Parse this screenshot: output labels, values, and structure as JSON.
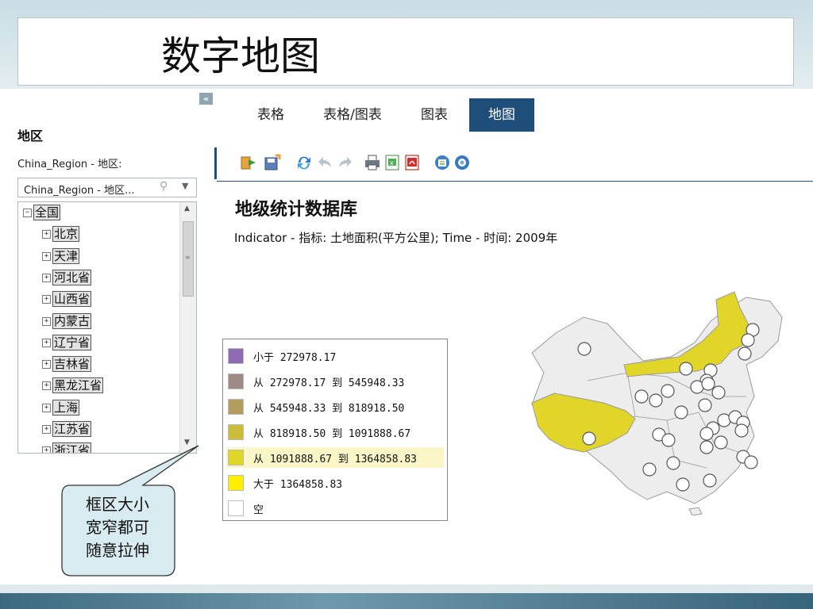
{
  "slide": {
    "title": "数字地图"
  },
  "left_panel": {
    "collapse_label": "«",
    "region_title": "地区",
    "region_subtitle": "China_Region - 地区:",
    "region_select_value": "China_Region - 地区...",
    "tree_items": [
      {
        "label": "全国",
        "toggle": "−"
      },
      {
        "label": "北京",
        "toggle": "+"
      },
      {
        "label": "天津",
        "toggle": "+"
      },
      {
        "label": "河北省",
        "toggle": "+"
      },
      {
        "label": "山西省",
        "toggle": "+"
      },
      {
        "label": "内蒙古",
        "toggle": "+"
      },
      {
        "label": "辽宁省",
        "toggle": "+"
      },
      {
        "label": "吉林省",
        "toggle": "+"
      },
      {
        "label": "黑龙江省",
        "toggle": "+"
      },
      {
        "label": "上海",
        "toggle": "+"
      },
      {
        "label": "江苏省",
        "toggle": "+"
      },
      {
        "label": "浙江省",
        "toggle": "+"
      }
    ]
  },
  "callout": {
    "lines": [
      "框区大小",
      "宽窄都可",
      "随意拉伸"
    ]
  },
  "tabs": [
    {
      "label": "表格",
      "active": false
    },
    {
      "label": "表格/图表",
      "active": false
    },
    {
      "label": "图表",
      "active": false
    },
    {
      "label": "地图",
      "active": true
    }
  ],
  "toolbar": {
    "icons": [
      "open-folder-icon",
      "save-icon",
      "refresh-icon",
      "undo-icon",
      "redo-icon",
      "print-icon",
      "excel-export-icon",
      "pdf-export-icon",
      "info-icon",
      "settings-icon"
    ]
  },
  "report": {
    "title": "地级统计数据库",
    "subtitle": "Indicator - 指标: 土地面积(平方公里); Time - 时间: 2009年"
  },
  "legend": {
    "items": [
      {
        "label": "小于 272978.17",
        "color": "#8e6bb0",
        "highlight": false
      },
      {
        "label": "从 272978.17 到 545948.33",
        "color": "#a08a86",
        "highlight": false
      },
      {
        "label": "从 545948.33 到 818918.50",
        "color": "#b29d5e",
        "highlight": false
      },
      {
        "label": "从 818918.50 到 1091888.67",
        "color": "#cdbb3a",
        "highlight": false
      },
      {
        "label": "从 1091888.67 到 1364858.83",
        "color": "#e2d52a",
        "highlight": true
      },
      {
        "label": "大于 1364858.83",
        "color": "#ffee00",
        "highlight": false
      },
      {
        "label": "空",
        "color": "#ffffff",
        "highlight": false
      }
    ]
  },
  "colors": {
    "accent": "#1e4e79",
    "map_highlight": "#e2d52a",
    "map_base": "#ededed"
  }
}
